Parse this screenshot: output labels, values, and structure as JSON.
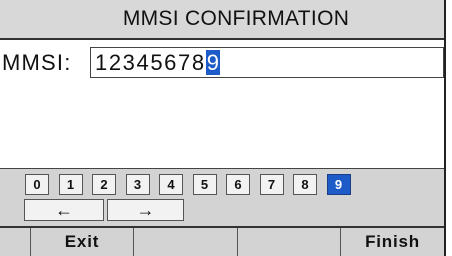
{
  "title": "MMSI CONFIRMATION",
  "mmsi": {
    "label": "MMSI:",
    "value": "12345678",
    "cursor_char": "9"
  },
  "keypad": {
    "digits": [
      "0",
      "1",
      "2",
      "3",
      "4",
      "5",
      "6",
      "7",
      "8",
      "9"
    ],
    "selected": "9",
    "left_arrow": "←",
    "right_arrow": "→"
  },
  "softkeys": [
    "",
    "Exit",
    "",
    "",
    "Finish"
  ],
  "colors": {
    "highlight": "#1d5cc8",
    "panel": "#d3d3d3",
    "title_bar": "#d8d8d8"
  }
}
